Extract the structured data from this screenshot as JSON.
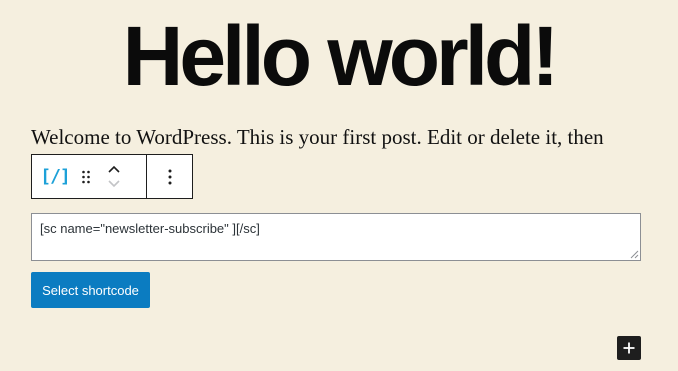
{
  "post": {
    "title": "Hello world!",
    "paragraph": "Welcome to WordPress. This is your first post. Edit or delete it, then"
  },
  "toolbar": {
    "block_icon": "[/]",
    "icons": {
      "block": "shortcode-icon",
      "drag": "drag-handle-icon",
      "move_up": "chevron-up-icon",
      "move_down": "chevron-down-icon",
      "options": "more-vertical-icon"
    }
  },
  "shortcode_block": {
    "input_value": "[sc name=\"newsletter-subscribe\" ][/sc]",
    "select_button_label": "Select shortcode"
  },
  "inserter": {
    "icon": "plus-icon"
  },
  "colors": {
    "background": "#f5efdf",
    "accent": "#0b7cc1",
    "block_icon": "#1da1d8",
    "dark": "#1e1e1e"
  }
}
